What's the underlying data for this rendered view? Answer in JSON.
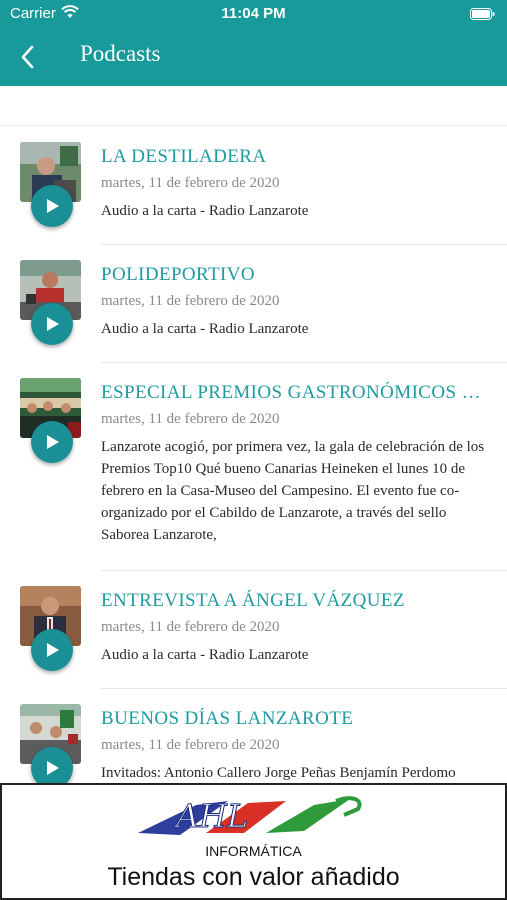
{
  "status": {
    "carrier": "Carrier",
    "time": "11:04 PM"
  },
  "header": {
    "title": "Podcasts"
  },
  "colors": {
    "accent": "#18999a",
    "title_text": "#1e9aa0",
    "play_button": "#1a8f96"
  },
  "podcasts": [
    {
      "title": "LA DESTILADERA",
      "date": "martes, 11 de febrero de 2020",
      "description": "Audio a la carta - Radio Lanzarote"
    },
    {
      "title": "POLIDEPORTIVO",
      "date": "martes, 11 de febrero de 2020",
      "description": "Audio a la carta - Radio Lanzarote"
    },
    {
      "title": "ESPECIAL PREMIOS GASTRONÓMICOS …",
      "date": "martes, 11 de febrero de 2020",
      "description": "Lanzarote acogió, por primera vez, la gala de celebración de los Premios Top10 Qué bueno Canarias Heineken el lunes 10 de febrero en la Casa-Museo del Campesino. El evento fue co-organizado por el Cabildo de Lanzarote, a través del sello Saborea Lanzarote,"
    },
    {
      "title": "ENTREVISTA A ÁNGEL VÁZQUEZ",
      "date": "martes, 11 de febrero de 2020",
      "description": "Audio a la carta - Radio Lanzarote"
    },
    {
      "title": "BUENOS DÍAS LANZAROTE",
      "date": "martes, 11 de febrero de 2020",
      "description": "Invitados: Antonio Callero Jorge Peñas Benjamín Perdomo"
    }
  ],
  "ad": {
    "logo_text": "AHL",
    "subtitle": "INFORMÁTICA",
    "tagline": "Tiendas con valor añadido"
  }
}
